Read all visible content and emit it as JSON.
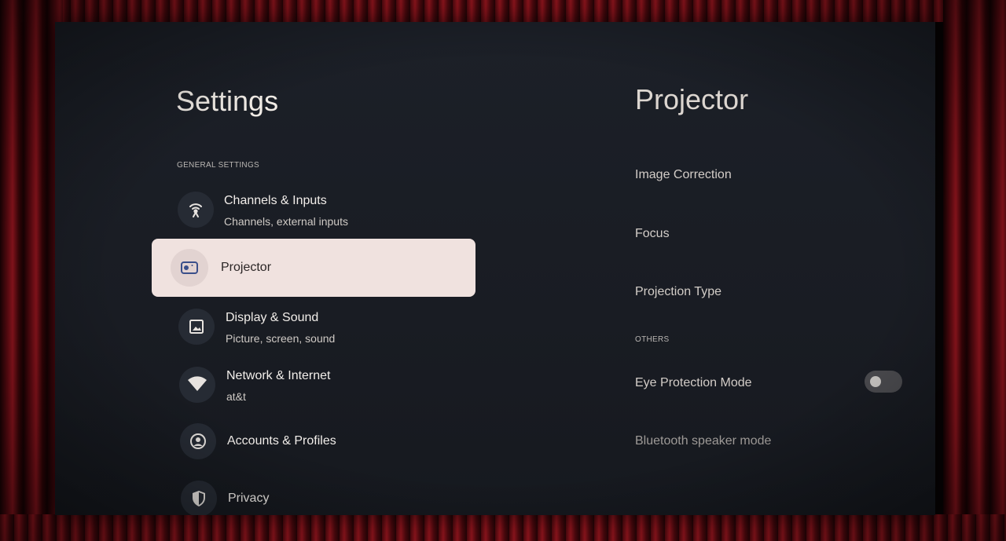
{
  "left": {
    "title": "Settings",
    "section_general": "GENERAL SETTINGS",
    "items": [
      {
        "label": "Channels & Inputs",
        "sublabel": "Channels, external inputs",
        "icon": "antenna-icon"
      },
      {
        "label": "Projector",
        "sublabel": "",
        "icon": "projector-icon",
        "selected": true
      },
      {
        "label": "Display & Sound",
        "sublabel": "Picture, screen, sound",
        "icon": "image-icon"
      },
      {
        "label": "Network & Internet",
        "sublabel": "at&t",
        "icon": "wifi-icon"
      },
      {
        "label": "Accounts & Profiles",
        "sublabel": "",
        "icon": "account-icon"
      },
      {
        "label": "Privacy",
        "sublabel": "",
        "icon": "shield-icon"
      }
    ]
  },
  "right": {
    "title": "Projector",
    "items": [
      {
        "label": "Image Correction"
      },
      {
        "label": "Focus"
      },
      {
        "label": "Projection Type"
      }
    ],
    "section_others": "OTHERS",
    "others": [
      {
        "label": "Eye Protection Mode",
        "toggle": false
      },
      {
        "label": "Bluetooth speaker mode"
      }
    ]
  },
  "colors": {
    "selected_bg": "#f0e2df",
    "screen_bg": "#1b1e25",
    "curtain": "#a81822"
  }
}
